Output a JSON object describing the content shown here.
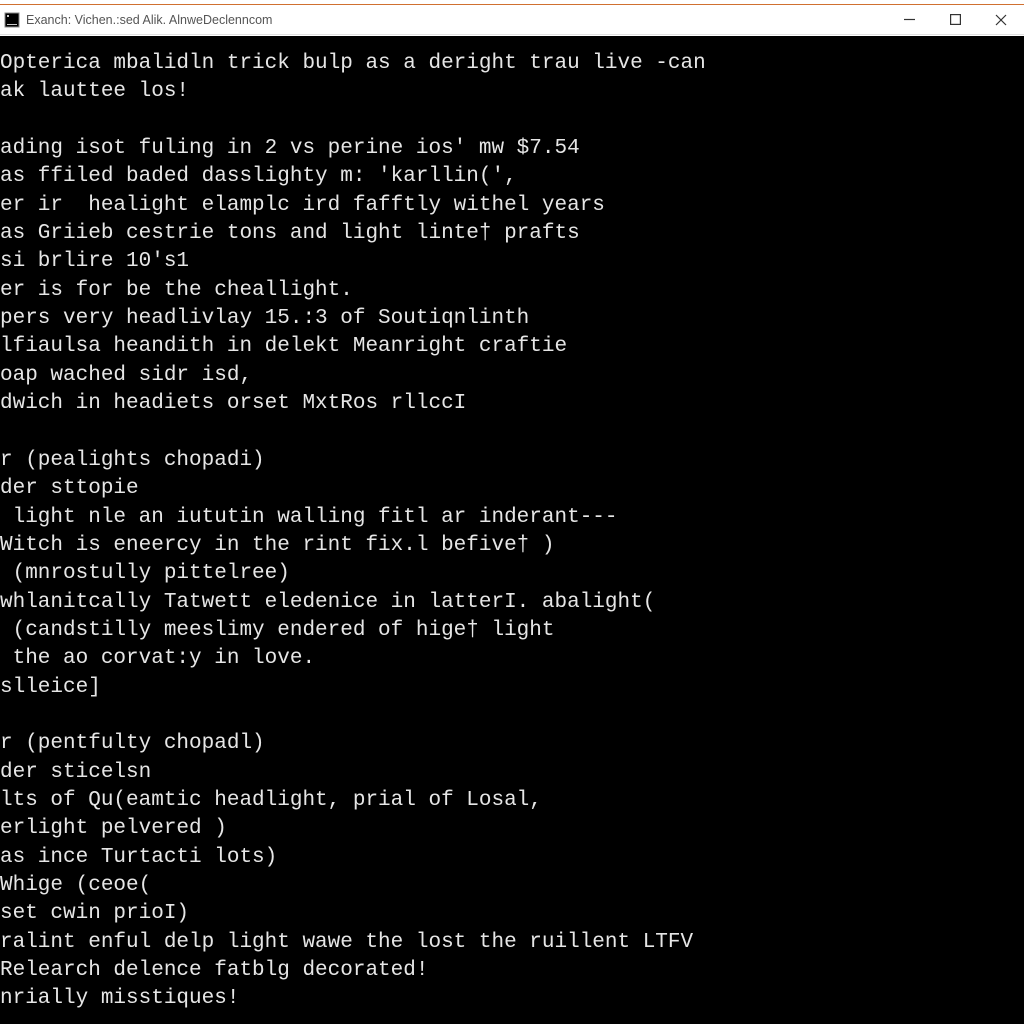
{
  "window": {
    "title": "Exanch: Vichen.:sed Alik. AlnweDeclenncom"
  },
  "terminal": {
    "lines": [
      "Opterica mbalidln trick bulp as a deright trau live -can",
      "ak lauttee los!",
      "",
      "ading isot fuling in 2 vs perine ios' mw $7.54",
      "as ffiled baded dasslighty m: 'karllin(',",
      "er ir  healight elamplc ird fafftly withel years",
      "as Griieb cestrie tons and light linte† prafts",
      "si brlire 10's1",
      "er is for be the cheallight.",
      "pers very headlivlay 15.:3 of Soutiqnlinth",
      "lfiaulsa heandith in delekt Meanright craftie",
      "oap wached sidr isd,",
      "dwich in headiets orset MxtRos rllccI",
      "",
      "r (pealights chopadi)",
      "der sttopie",
      " light nle an iututin walling fitl ar inderant---",
      "Witch is eneercy in the rint fix.l befive† )",
      " (mnrostully pittelree)",
      "whlanitcally Tatwett eledenice in latterI. abalight(",
      " (candstilly meeslimy endered of hige† light",
      " the ao corvat:y in love.",
      "slleice]",
      "",
      "r (pentfulty chopadl)",
      "der sticelsn",
      "lts of Qu(eamtic headlight, prial of Losal,",
      "erlight pelvered )",
      "as ince Turtacti lots)",
      "Whige (ceoe(",
      "set cwin prioI)",
      "ralint enful delp light wawe the lost the ruillent LTFV",
      "Relearch delence fatblg decorated!",
      "nrially misstiques!"
    ]
  }
}
